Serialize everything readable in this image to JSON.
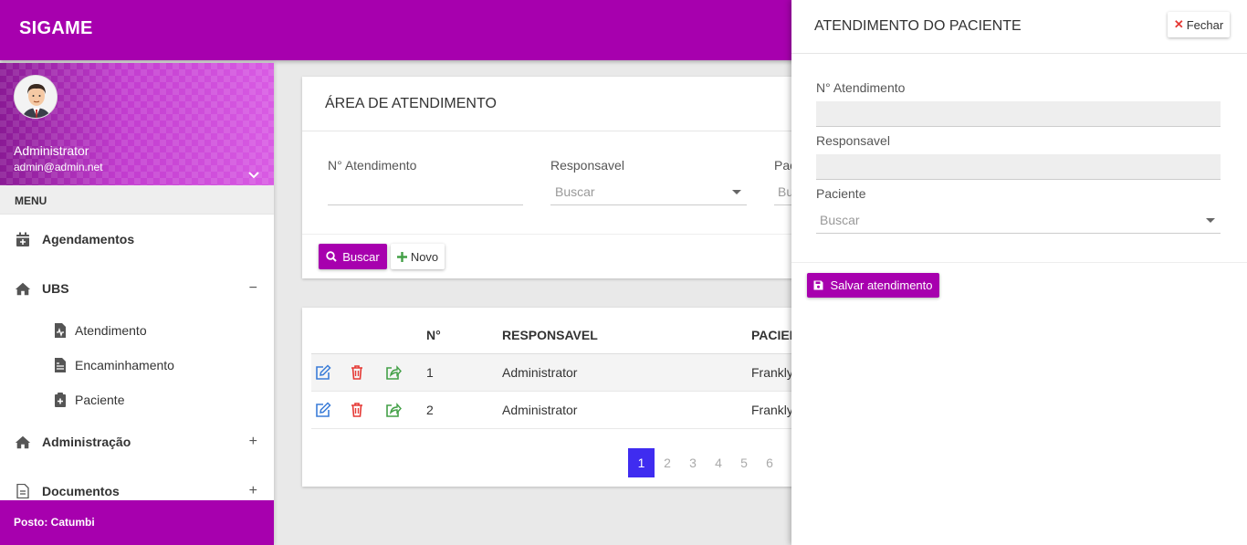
{
  "app": {
    "brand": "SIGAME"
  },
  "user": {
    "name": "Administrator",
    "email": "admin@admin.net",
    "caret_icon": "chevron-down-icon"
  },
  "sidebar": {
    "menu_header": "MENU",
    "items": [
      {
        "label": "Agendamentos",
        "icon": "calendar-plus-icon"
      },
      {
        "label": "UBS",
        "icon": "home-icon",
        "toggle": "−",
        "children": [
          {
            "label": "Atendimento",
            "icon": "file-medical-icon"
          },
          {
            "label": "Encaminhamento",
            "icon": "file-medical-alt-icon"
          },
          {
            "label": "Paciente",
            "icon": "clipboard-plus-icon"
          }
        ]
      },
      {
        "label": "Administração",
        "icon": "home-icon",
        "toggle": "+"
      },
      {
        "label": "Documentos",
        "icon": "file-icon",
        "toggle": "+"
      }
    ],
    "footer": "Posto: Catumbi"
  },
  "search_card": {
    "title": "ÁREA DE ATENDIMENTO",
    "fields": {
      "atendimento_label": "N° Atendimento",
      "responsavel_label": "Responsavel",
      "responsavel_placeholder": "Buscar",
      "paciente_label": "Pac",
      "paciente_placeholder": "Bu"
    },
    "buscar_label": "Buscar",
    "novo_label": "Novo"
  },
  "table": {
    "headers": {
      "numero": "N°",
      "responsavel": "RESPONSAVEL",
      "paciente": "PACIEN"
    },
    "rows": [
      {
        "numero": "1",
        "responsavel": "Administrator",
        "paciente": "Frankly"
      },
      {
        "numero": "2",
        "responsavel": "Administrator",
        "paciente": "Frankly"
      }
    ],
    "pages": [
      "1",
      "2",
      "3",
      "4",
      "5",
      "6"
    ],
    "current_page": "1"
  },
  "panel": {
    "title": "ATENDIMENTO DO PACIENTE",
    "close_label": "Fechar",
    "atendimento_label": "N° Atendimento",
    "atendimento_value": "",
    "responsavel_label": "Responsavel",
    "responsavel_value": "",
    "paciente_label": "Paciente",
    "paciente_placeholder": "Buscar",
    "save_label": "Salvar atendimento"
  },
  "colors": {
    "primary": "#a700ae",
    "pager_active": "#3f2cf0",
    "edit": "#3b7dd8",
    "delete": "#e53935",
    "share": "#43a047"
  }
}
